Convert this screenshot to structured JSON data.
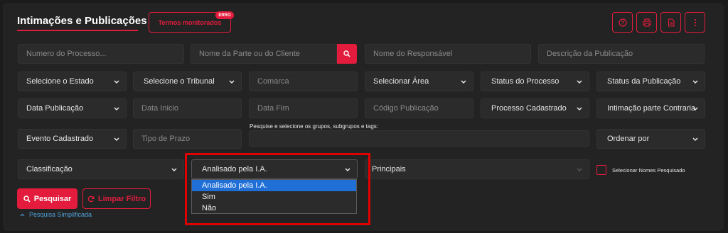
{
  "header": {
    "title": "Intimações e Publicações",
    "termos_label": "Termos monitorados",
    "badge": "ERRO"
  },
  "toolbar": {
    "icons": [
      "help-icon",
      "print-icon",
      "document-icon",
      "more-icon"
    ]
  },
  "filters": {
    "row1": {
      "processo": "Numero do Processo...",
      "parte": "Nome da Parte ou do Cliente",
      "responsavel": "Nome do Responsável",
      "descricao": "Descrição da Publicação"
    },
    "row2": {
      "estado": "Selecione o Estado",
      "tribunal": "Selecione o Tribunal",
      "comarca": "Comarca",
      "area": "Selecionar Área",
      "status_processo": "Status do Processo",
      "status_publicacao": "Status da Publicação"
    },
    "row3": {
      "data_publicacao": "Data Publicação",
      "data_inicio": "Data Inicio",
      "data_fim": "Data Fim",
      "codigo": "Código Publicação",
      "processo_cadastrado": "Processo Cadastrado",
      "intimacao": "Intimação parte Contraria"
    },
    "row4": {
      "evento": "Evento Cadastrado",
      "tipo_prazo": "Tipo de Prazo",
      "grupos_hint": "Pesquise e selecione os grupos, subgrupos e tags:",
      "ordenar": "Ordenar por"
    },
    "row5": {
      "classificacao": "Classificação",
      "ia_select": "Analisado pela I.A.",
      "principais": "Principais",
      "checkbox_label": "Selecionar Nomes Pesquisado"
    }
  },
  "dropdown": {
    "options": [
      "Analisado pela I.A.",
      "Sim",
      "Não"
    ],
    "selected_index": 0
  },
  "actions": {
    "pesquisar": "Pesquisar",
    "limpar": "Limpar Filtro",
    "simplificada": "Pesquisa Simplificada"
  },
  "colors": {
    "accent": "#e31c3d",
    "highlight": "#e00000",
    "link": "#4ea0d8",
    "option_active": "#1f6fd6"
  }
}
